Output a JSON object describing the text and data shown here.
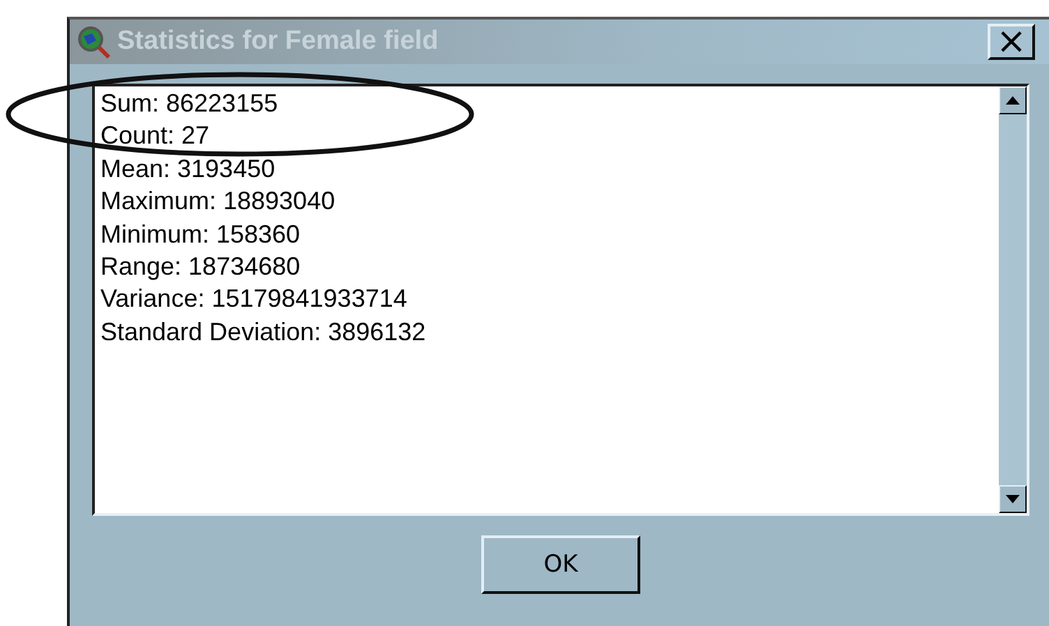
{
  "window": {
    "title": "Statistics for Female field",
    "close": "×"
  },
  "statistics": [
    "Sum: 86223155",
    "Count: 27",
    "Mean: 3193450",
    "Maximum: 18893040",
    "Minimum: 158360",
    "Range: 18734680",
    "Variance: 15179841933714",
    "Standard Deviation: 3896132"
  ],
  "buttons": [
    "OK"
  ]
}
